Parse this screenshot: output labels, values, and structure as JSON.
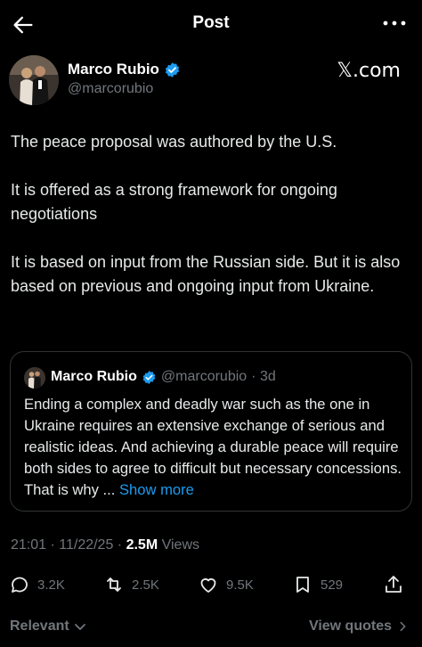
{
  "header": {
    "title": "Post"
  },
  "author": {
    "name": "Marco Rubio",
    "handle": "@marcorubio",
    "source": "𝕏.com"
  },
  "post": {
    "paragraphs": [
      "The peace proposal was authored by the U.S.",
      "It is offered as a strong framework for ongoing negotiations",
      "It is based on input from the Russian side. But it is also based on previous and ongoing input from Ukraine."
    ]
  },
  "quote": {
    "name": "Marco Rubio",
    "handle": "@marcorubio",
    "time": "· 3d",
    "text": "Ending a complex and deadly war such as the one in Ukraine requires an extensive exchange of serious and realistic ideas. And achieving a durable peace will require both sides to agree to difficult but necessary concessions. That is why ...",
    "show_more": "Show more"
  },
  "meta": {
    "datetime": "21:01 · 11/22/25 · ",
    "views": "2.5M",
    "views_label": "Views"
  },
  "actions": {
    "replies": "3.2K",
    "reposts": "2.5K",
    "likes": "9.5K",
    "bookmarks": "529"
  },
  "footer": {
    "sort": "Relevant",
    "view_quotes": "View quotes"
  },
  "colors": {
    "background": "#000000",
    "text": "#e7e9ea",
    "muted": "#71767b",
    "link": "#1d9bf0",
    "verified": "#1d9bf0",
    "border": "#2f3336"
  },
  "icons": [
    "back-arrow-icon",
    "more-icon",
    "verified-icon",
    "reply-icon",
    "repost-icon",
    "like-icon",
    "bookmark-icon",
    "share-icon",
    "chevron-down-icon",
    "chevron-right-icon"
  ]
}
